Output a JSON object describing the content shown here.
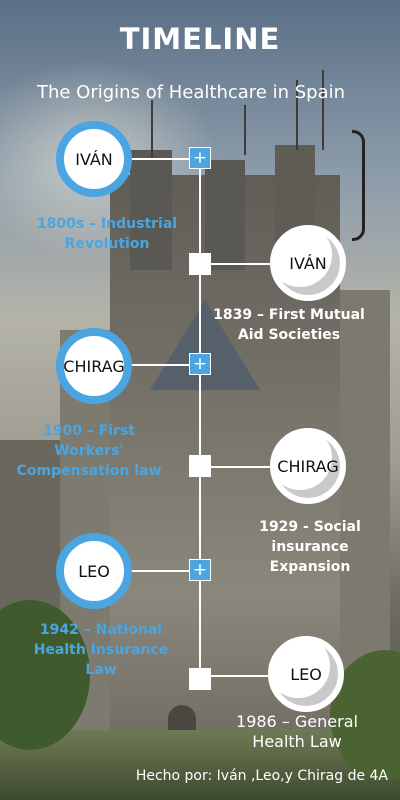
{
  "header": {
    "title": "TIMELINE",
    "subtitle": "The Origins of Healthcare in Spain"
  },
  "colors": {
    "accent": "#4aa5e0",
    "text_light": "#ffffff"
  },
  "timeline": {
    "markers": {
      "plus_label": "+"
    },
    "events": [
      {
        "person": "IVÁN",
        "title": "1800s – Industrial Revolution"
      },
      {
        "person": "IVÁN",
        "title": "1839 – First Mutual Aid Societies"
      },
      {
        "person": "CHIRAG",
        "title": "1900 – First Workers' Compensation law"
      },
      {
        "person": "CHIRAG",
        "title": "1929 - Social insurance Expansion"
      },
      {
        "person": "LEO",
        "title": "1942 – National Health Insurance Law"
      },
      {
        "person": "LEO",
        "title": "1986 – General Health Law"
      }
    ]
  },
  "footer": {
    "credit": "Hecho por: Iván ,Leo,y Chirag de 4A"
  },
  "icons": [
    "plus-icon"
  ]
}
